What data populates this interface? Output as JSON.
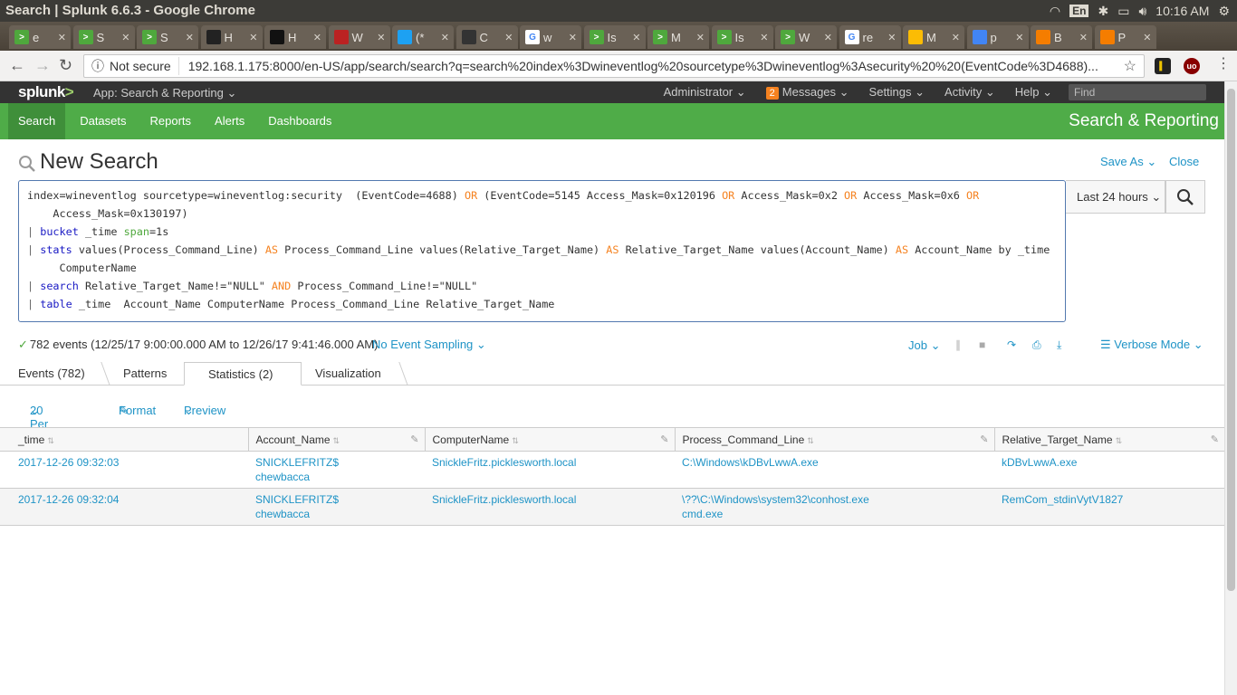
{
  "os": {
    "window_title": "Search | Splunk 6.6.3 - Google Chrome",
    "lang": "En",
    "clock": "10:16 AM"
  },
  "browser": {
    "tabs": [
      {
        "label": "e",
        "icon": "terminal-icon",
        "color": "#4fa83d"
      },
      {
        "label": "S",
        "icon": "terminal-icon",
        "color": "#4fa83d"
      },
      {
        "label": "S",
        "icon": "terminal-icon",
        "color": "#4fa83d"
      },
      {
        "label": "H",
        "icon": "record-icon",
        "color": "#222"
      },
      {
        "label": "H",
        "icon": "m-icon",
        "color": "#111"
      },
      {
        "label": "W",
        "icon": "shield-icon",
        "color": "#b22"
      },
      {
        "label": "(*",
        "icon": "twitter-icon",
        "color": "#1da1f2"
      },
      {
        "label": "C",
        "icon": "github-icon",
        "color": "#333"
      },
      {
        "label": "w",
        "icon": "google-icon",
        "color": "#fff"
      },
      {
        "label": "Is",
        "icon": "terminal-icon",
        "color": "#4fa83d"
      },
      {
        "label": "M",
        "icon": "terminal-icon",
        "color": "#4fa83d"
      },
      {
        "label": "Is",
        "icon": "terminal-icon",
        "color": "#4fa83d"
      },
      {
        "label": "W",
        "icon": "terminal-icon",
        "color": "#4fa83d"
      },
      {
        "label": "re",
        "icon": "google-icon",
        "color": "#fff"
      },
      {
        "label": "M",
        "icon": "drive-icon",
        "color": "#fbbc04"
      },
      {
        "label": "p",
        "icon": "docs-icon",
        "color": "#4285f4"
      },
      {
        "label": "B",
        "icon": "blogger-icon",
        "color": "#f57d00"
      },
      {
        "label": "P",
        "icon": "blogger-icon",
        "color": "#f57d00"
      }
    ],
    "not_secure": "Not secure",
    "url": "192.168.1.175:8000/en-US/app/search/search?q=search%20index%3Dwineventlog%20sourcetype%3Dwineventlog%3Asecurity%20%20(EventCode%3D4688)..."
  },
  "splunkbar": {
    "logo": "splunk",
    "logo_mark": ">",
    "app_menu": "App: Search & Reporting",
    "user": "Administrator",
    "messages_count": "2",
    "messages": "Messages",
    "settings": "Settings",
    "activity": "Activity",
    "help": "Help",
    "find_placeholder": "Find"
  },
  "appbar": {
    "nav": [
      "Search",
      "Datasets",
      "Reports",
      "Alerts",
      "Dashboards"
    ],
    "app_title": "Search & Reporting"
  },
  "page": {
    "title": "New Search",
    "save_as": "Save As",
    "close": "Close"
  },
  "query": {
    "l1a": "index=wineventlog sourcetype=wineventlog:security  (EventCode=4688) ",
    "or": "OR",
    "l1b": " (EventCode=5145 Access_Mask=0x120196 ",
    "l1c": " Access_Mask=0x2 ",
    "l1d": " Access_Mask=0x6 ",
    "l2": "    Access_Mask=0x130197)",
    "pipe": "|",
    "bucket": "bucket",
    "l3a": " _time ",
    "span": "span",
    "l3b": "=1s",
    "stats": "stats",
    "l4a": " values(Process_Command_Line) ",
    "as": "AS",
    "l4b": " Process_Command_Line values(Relative_Target_Name) ",
    "l4c": " Relative_Target_Name values(Account_Name) ",
    "l4d": " Account_Name by _time",
    "l5": "     ComputerName",
    "search": "search",
    "l6a": " Relative_Target_Name!=\"NULL\" ",
    "and": "AND",
    "l6b": " Process_Command_Line!=\"NULL\"",
    "table": "table",
    "l7": " _time  Account_Name ComputerName Process_Command_Line Relative_Target_Name",
    "time_range": "Last 24 hours"
  },
  "status": {
    "events": "782 events (12/25/17 9:00:00.000 AM to 12/26/17 9:41:46.000 AM)",
    "sampling": "No Event Sampling",
    "job": "Job",
    "mode": "Verbose Mode"
  },
  "tabs": {
    "events": "Events (782)",
    "patterns": "Patterns",
    "statistics": "Statistics (2)",
    "visualization": "Visualization"
  },
  "options": {
    "per_page": "20 Per Page",
    "format": "Format",
    "preview": "Preview"
  },
  "table": {
    "columns": [
      "_time",
      "Account_Name",
      "ComputerName",
      "Process_Command_Line",
      "Relative_Target_Name"
    ],
    "rows": [
      {
        "time": "2017-12-26 09:32:03",
        "account1": "SNICKLEFRITZ$",
        "account2": "chewbacca",
        "computer": "SnickleFritz.picklesworth.local",
        "cmd1": "C:\\Windows\\kDBvLwwA.exe",
        "cmd2": "",
        "target": "kDBvLwwA.exe"
      },
      {
        "time": "2017-12-26 09:32:04",
        "account1": "SNICKLEFRITZ$",
        "account2": "chewbacca",
        "computer": "SnickleFritz.picklesworth.local",
        "cmd1": "\\??\\C:\\Windows\\system32\\conhost.exe",
        "cmd2": "cmd.exe",
        "target": "RemCom_stdinVytV1827"
      }
    ]
  }
}
